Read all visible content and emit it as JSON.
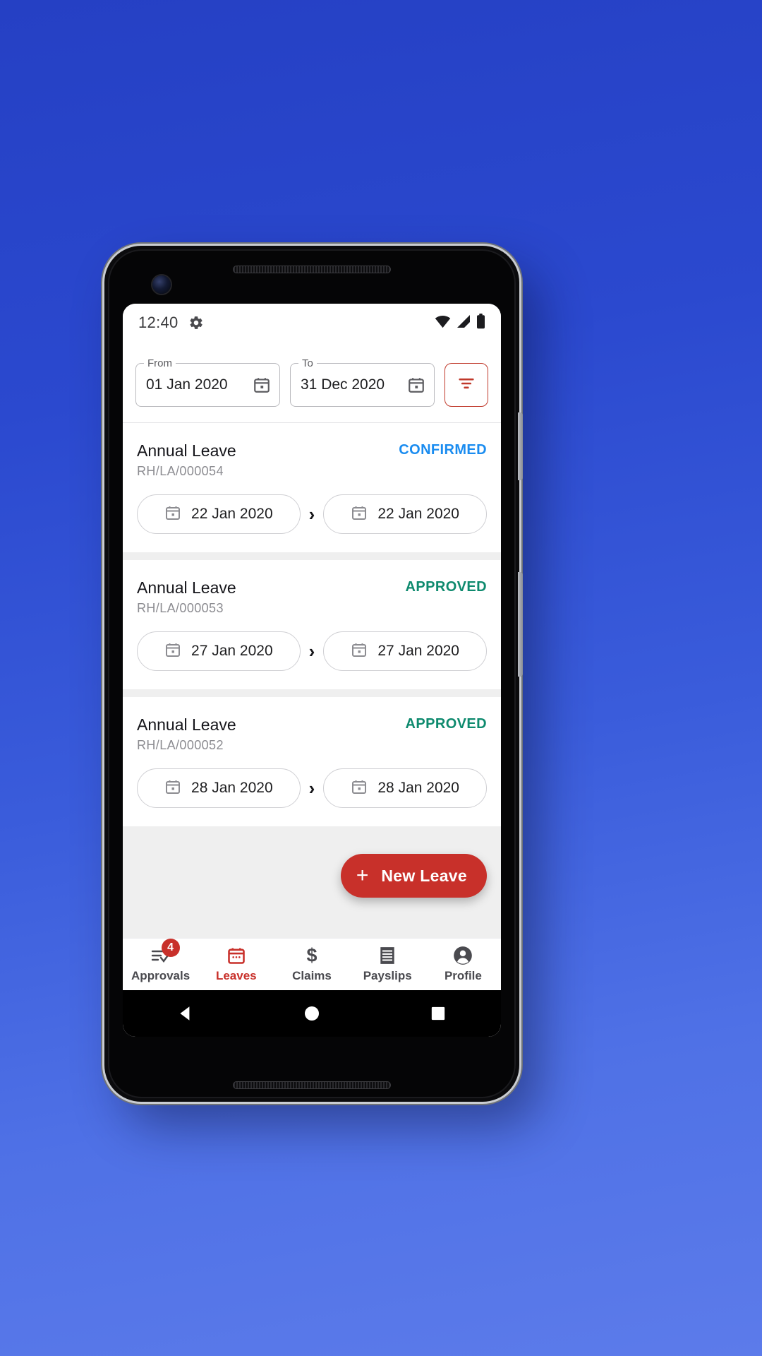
{
  "status_bar": {
    "time": "12:40",
    "icons": [
      "gear-icon",
      "wifi-icon",
      "cellular-signal-icon",
      "battery-icon"
    ]
  },
  "filter_bar": {
    "from": {
      "label": "From",
      "value": "01 Jan 2020",
      "icon": "calendar-icon"
    },
    "to": {
      "label": "To",
      "value": "31 Dec 2020",
      "icon": "calendar-icon"
    },
    "filter_button": {
      "icon": "filter-icon",
      "color": "#c0392b"
    }
  },
  "leaves": [
    {
      "title": "Annual Leave",
      "reference": "RH/LA/000054",
      "status": "CONFIRMED",
      "status_color": "#1a8cf0",
      "start_date": "22 Jan 2020",
      "end_date": "22 Jan 2020"
    },
    {
      "title": "Annual Leave",
      "reference": "RH/LA/000053",
      "status": "APPROVED",
      "status_color": "#0e8a6e",
      "start_date": "27 Jan 2020",
      "end_date": "27 Jan 2020"
    },
    {
      "title": "Annual Leave",
      "reference": "RH/LA/000052",
      "status": "APPROVED",
      "status_color": "#0e8a6e",
      "start_date": "28 Jan 2020",
      "end_date": "28 Jan 2020"
    }
  ],
  "fab": {
    "label": "New Leave",
    "icon": "plus-icon",
    "color": "#c8302a"
  },
  "bottom_nav": {
    "active": "Leaves",
    "items": [
      {
        "label": "Approvals",
        "icon": "approvals-checklist-icon",
        "badge": "4"
      },
      {
        "label": "Leaves",
        "icon": "calendar-icon",
        "badge": ""
      },
      {
        "label": "Claims",
        "icon": "dollar-icon",
        "badge": ""
      },
      {
        "label": "Payslips",
        "icon": "receipt-icon",
        "badge": ""
      },
      {
        "label": "Profile",
        "icon": "person-circle-icon",
        "badge": ""
      }
    ]
  },
  "system_nav": {
    "back": "back-triangle-icon",
    "home": "home-circle-icon",
    "recents": "recents-square-icon"
  }
}
